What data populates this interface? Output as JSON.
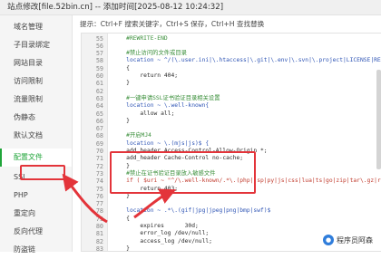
{
  "window": {
    "title": "站点修改[file.52bin.cn] -- 添加时间[2025-08-12 10:24:32]"
  },
  "sidebar": {
    "items": [
      {
        "label": "域名管理"
      },
      {
        "label": "子目录绑定"
      },
      {
        "label": "网站目录"
      },
      {
        "label": "访问限制"
      },
      {
        "label": "流量限制"
      },
      {
        "label": "伪静态"
      },
      {
        "label": "默认文档"
      },
      {
        "label": "配置文件",
        "active": true
      },
      {
        "label": "SSL"
      },
      {
        "label": "PHP"
      },
      {
        "label": "重定向"
      },
      {
        "label": "反向代理"
      },
      {
        "label": "防盗链"
      }
    ]
  },
  "editor": {
    "hint": "提示：Ctrl+F 搜索关键字，Ctrl+S 保存，Ctrl+H 查找替换",
    "lines": [
      {
        "n": "55",
        "text": "    #REWRITE-END",
        "cls": "c-comment"
      },
      {
        "n": "56",
        "text": "",
        "cls": ""
      },
      {
        "n": "57",
        "text": "    #禁止访问的文件或目录",
        "cls": "c-comment"
      },
      {
        "n": "58",
        "text": "    location ~ ^/(\\.user.ini|\\.htaccess|\\.git|\\.env|\\.svn|\\.project|LICENSE|README.md)",
        "cls": "c-key"
      },
      {
        "n": "59",
        "text": "    {",
        "cls": ""
      },
      {
        "n": "60",
        "text": "        return 404;",
        "cls": ""
      },
      {
        "n": "61",
        "text": "    }",
        "cls": ""
      },
      {
        "n": "62",
        "text": "",
        "cls": ""
      },
      {
        "n": "63",
        "text": "    #一键申请SSL证书验证目录相关设置",
        "cls": "c-comment"
      },
      {
        "n": "64",
        "text": "    location ~ \\.well-known{",
        "cls": "c-key"
      },
      {
        "n": "65",
        "text": "        allow all;",
        "cls": ""
      },
      {
        "n": "66",
        "text": "    }",
        "cls": ""
      },
      {
        "n": "67",
        "text": "",
        "cls": ""
      },
      {
        "n": "68",
        "text": "    #开启MJ4",
        "cls": "c-comment"
      },
      {
        "n": "69",
        "text": "    location ~ \\.(mjs|js)$ {",
        "cls": "c-key"
      },
      {
        "n": "70",
        "text": "    add_header Access-Control-Allow-Origin *;",
        "cls": ""
      },
      {
        "n": "71",
        "text": "    add_header Cache-Control no-cache;",
        "cls": ""
      },
      {
        "n": "72",
        "text": "    }",
        "cls": ""
      },
      {
        "n": "73",
        "text": "    #禁止在证书验证目录放入敏感文件",
        "cls": "c-comment"
      },
      {
        "n": "74",
        "text": "    if ( $uri ~ \"^/\\.well-known/.*\\.(php|jsp|py|js|css|lua|ts|go|zip|tar\\.gz|rar|7z|sql|bak)",
        "cls": "c-str"
      },
      {
        "n": "75",
        "text": "        return 403;",
        "cls": ""
      },
      {
        "n": "76",
        "text": "    }",
        "cls": ""
      },
      {
        "n": "77",
        "text": "",
        "cls": ""
      },
      {
        "n": "78",
        "text": "    location ~ .*\\.(gif|jpg|jpeg|png|bmp|swf)$",
        "cls": "c-key"
      },
      {
        "n": "79",
        "text": "    {",
        "cls": ""
      },
      {
        "n": "80",
        "text": "        expires      30d;",
        "cls": ""
      },
      {
        "n": "81",
        "text": "        error_log /dev/null;",
        "cls": ""
      },
      {
        "n": "82",
        "text": "        access_log /dev/null;",
        "cls": ""
      },
      {
        "n": "83",
        "text": "    }",
        "cls": ""
      }
    ]
  },
  "watermark": {
    "text": "程序员阿森"
  },
  "colors": {
    "accent": "#20a53a",
    "annotation": "#e3343a"
  }
}
